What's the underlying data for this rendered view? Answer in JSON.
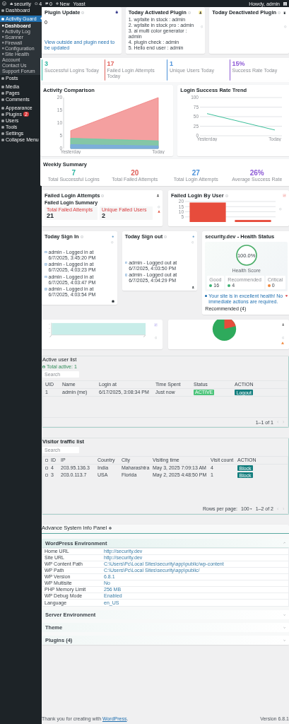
{
  "admin_bar": {
    "site": "security",
    "updates": "4",
    "comments": "0",
    "new": "New",
    "extra": "Yoast",
    "greeting": "Howdy, admin"
  },
  "sidebar": {
    "items": [
      {
        "label": "Dashboard",
        "selected": false
      },
      {
        "label": "Activity Guard",
        "selected": true,
        "children": [
          {
            "label": "Dashboard",
            "selected": true,
            "kind": "page"
          },
          {
            "label": "Activity Log",
            "selected": false,
            "kind": "page"
          },
          {
            "label": "Scanner",
            "selected": false,
            "kind": "page"
          },
          {
            "label": "Firewall",
            "selected": false,
            "kind": "page"
          },
          {
            "label": "Configuration",
            "selected": false,
            "kind": "page"
          },
          {
            "label": "Site Health",
            "selected": false,
            "kind": "page"
          },
          {
            "label": "Account",
            "selected": false,
            "kind": "link"
          },
          {
            "label": "Contact Us",
            "selected": false,
            "kind": "link"
          },
          {
            "label": "Support Forum",
            "selected": false,
            "kind": "link"
          }
        ]
      },
      {
        "label": "Posts",
        "selected": false
      },
      {
        "label": "Media",
        "selected": false
      },
      {
        "label": "Pages",
        "selected": false
      },
      {
        "label": "Comments",
        "selected": false
      },
      {
        "label": "Appearance",
        "selected": false
      },
      {
        "label": "Plugins",
        "selected": false,
        "badge": "2"
      },
      {
        "label": "Users",
        "selected": false
      },
      {
        "label": "Tools",
        "selected": false
      },
      {
        "label": "Settings",
        "selected": false
      },
      {
        "label": "Collapse Menu",
        "selected": false
      }
    ]
  },
  "plugin_update": {
    "title": "Plugin Update",
    "count": "0",
    "link": "View outside and plugin need to be updated"
  },
  "activated_plugins": {
    "title": "Today Activated Plugin",
    "items": [
      "1. wpfalte in stock : admin",
      "2. wpfalte in stock pro : admin",
      "3. ai multi color generator : admin",
      "4. plugin check : admin",
      "5. Hello end user : admin"
    ]
  },
  "deactivated_plugins": {
    "title": "Today Deactivated Plugin"
  },
  "stats": [
    {
      "value": "3",
      "label": "Successful Logins Today",
      "color": "#2bb5a0"
    },
    {
      "value": "17",
      "label": "Failed Login Attempts Today",
      "color": "#e0605a"
    },
    {
      "value": "1",
      "label": "Unique Users Today",
      "color": "#4a90d9"
    },
    {
      "value": "15%",
      "label": "Success Rate Today",
      "color": "#8e5bd6"
    }
  ],
  "activity_chart": {
    "title": "Activity Comparison",
    "chart_data": {
      "type": "area",
      "categories": [
        "Yesterday",
        "Today"
      ],
      "series": [
        {
          "color": "#f08080",
          "values": [
            7,
            20
          ]
        },
        {
          "color": "#5fd3a8",
          "values": [
            4,
            3
          ]
        },
        {
          "color": "#7aa7e8",
          "values": [
            1.5,
            1
          ]
        }
      ],
      "ylim": [
        0,
        20
      ],
      "yticks": [
        0,
        5,
        10,
        15,
        20
      ]
    }
  },
  "trend_chart": {
    "title": "Login Success Rate Trend",
    "chart_data": {
      "type": "line",
      "categories": [
        "Yesterday",
        "Today"
      ],
      "series": [
        {
          "color": "#3bbf9a",
          "values": [
            58,
            15
          ]
        }
      ],
      "ylim": [
        0,
        100
      ],
      "yticks": [
        0,
        25,
        50,
        75,
        100
      ],
      "grid": true
    }
  },
  "weekly_summary": {
    "title": "Weekly Summary",
    "items": [
      {
        "value": "7",
        "label": "Total Successful Logins",
        "color": "#2bb5a0"
      },
      {
        "value": "20",
        "label": "Total Failed Attempts",
        "color": "#e0605a"
      },
      {
        "value": "27",
        "label": "Total Login Attempts",
        "color": "#4a90d9"
      },
      {
        "value": "26%",
        "label": "Average Success Rate",
        "color": "#8e5bd6"
      }
    ]
  },
  "failed_attempts": {
    "title": "Failed Login Attempts",
    "subtitle": "Failed Login Summary",
    "total_label": "Total Failed Attempts",
    "total": "21",
    "unique_label": "Unique Failed Users",
    "unique": "2"
  },
  "failed_by_user": {
    "title": "Failed Login By User",
    "chart_data": {
      "type": "bar",
      "values": [
        19,
        2
      ],
      "color": "#e74c3c",
      "ylim": [
        0,
        20
      ],
      "yticks": [
        5,
        10,
        15,
        20
      ],
      "grid": true
    }
  },
  "sign_in": {
    "title": "Today Sign In",
    "items": [
      "admin - Logged in at 6/7/2025, 3:45:20 PM",
      "admin - Logged in at 6/7/2025, 4:03:23 PM",
      "admin - Logged in at 6/7/2025, 4:03:47 PM",
      "admin - Logged in at 6/7/2025, 4:03:54 PM"
    ]
  },
  "sign_out": {
    "title": "Today Sign out",
    "items": [
      "admin - Logged out at 6/7/2025, 4:03:50 PM",
      "admin - Logged out at 6/7/2025, 4:04:29 PM"
    ]
  },
  "health": {
    "title": "security.dev - Health Status",
    "score": "100.0%",
    "level": 1,
    "score_label": "Health Score",
    "stats": [
      {
        "label": "Good",
        "value": "16",
        "color": "#3bb273"
      },
      {
        "label": "Recommended",
        "value": "4",
        "color": "#3bb273"
      },
      {
        "label": "Critical",
        "value": "0",
        "color": "#f0883e"
      }
    ],
    "message": "Your site is in excellent health! No immediate actions are required.",
    "recommended": "Recommended (4)"
  },
  "active_users": {
    "title": "Active user list",
    "total": "Total active: 1",
    "search": {
      "placeholder": "Search"
    },
    "columns": [
      "UID",
      "Name",
      "Login at",
      "Time Spent",
      "Status",
      "ACTION"
    ],
    "rows": [
      {
        "cells": [
          "1",
          "admin (me)",
          "6/17/2025, 3:08:34 PM",
          "Just now"
        ],
        "status": "ACTIVE",
        "action": "Logout"
      }
    ],
    "pagination": "1–1 of 1"
  },
  "visitors": {
    "title": "Visitor traffic list",
    "search": {
      "placeholder": "Search"
    },
    "header_checked": false,
    "columns": [
      "ID",
      "IP",
      "Country",
      "City",
      "Visiting time",
      "Visit count",
      "ACTION"
    ],
    "rows": [
      {
        "checked": false,
        "cells": [
          "4",
          "203.95.136.3",
          "India",
          "Maharashtra",
          "May 3, 2025 7:09:13 AM",
          "4"
        ],
        "action": "Block"
      },
      {
        "checked": false,
        "cells": [
          "3",
          "203.0.113.7",
          "USA",
          "Florida",
          "May 2, 2025 4:48:50 PM",
          "1"
        ],
        "action": "Block"
      }
    ],
    "rows_per_page_label": "Rows per page:",
    "rows_per_page": "100",
    "pagination": "1–2 of 2"
  },
  "system_info": {
    "title": "Advance System Info Panel",
    "sections": [
      {
        "title": "WordPress Environment",
        "expanded": true,
        "rows": [
          {
            "label": "Home URL",
            "value": "http://security.dev"
          },
          {
            "label": "Site URL",
            "value": "http://security.dev"
          },
          {
            "label": "WP Content Path",
            "value": "C:\\Users\\Pc\\Local Sites\\security\\app\\public/wp-content"
          },
          {
            "label": "WP Path",
            "value": "C:\\Users\\Pc\\Local Sites\\security\\app\\public/"
          },
          {
            "label": "WP Version",
            "value": "6.8.1"
          },
          {
            "label": "WP Multisite",
            "value": "No"
          },
          {
            "label": "PHP Memory Limit",
            "value": "256 MB"
          },
          {
            "label": "WP Debug Mode",
            "value": "Enabled"
          },
          {
            "label": "Language",
            "value": "en_US"
          }
        ]
      },
      {
        "title": "Server Environment",
        "expanded": false
      },
      {
        "title": "Theme",
        "expanded": false
      },
      {
        "title": "Plugins (4)",
        "expanded": false
      }
    ]
  },
  "footer": {
    "text": "Thank you for creating with",
    "link": "WordPress",
    "suffix": ".",
    "version": "Version 6.8.1"
  }
}
